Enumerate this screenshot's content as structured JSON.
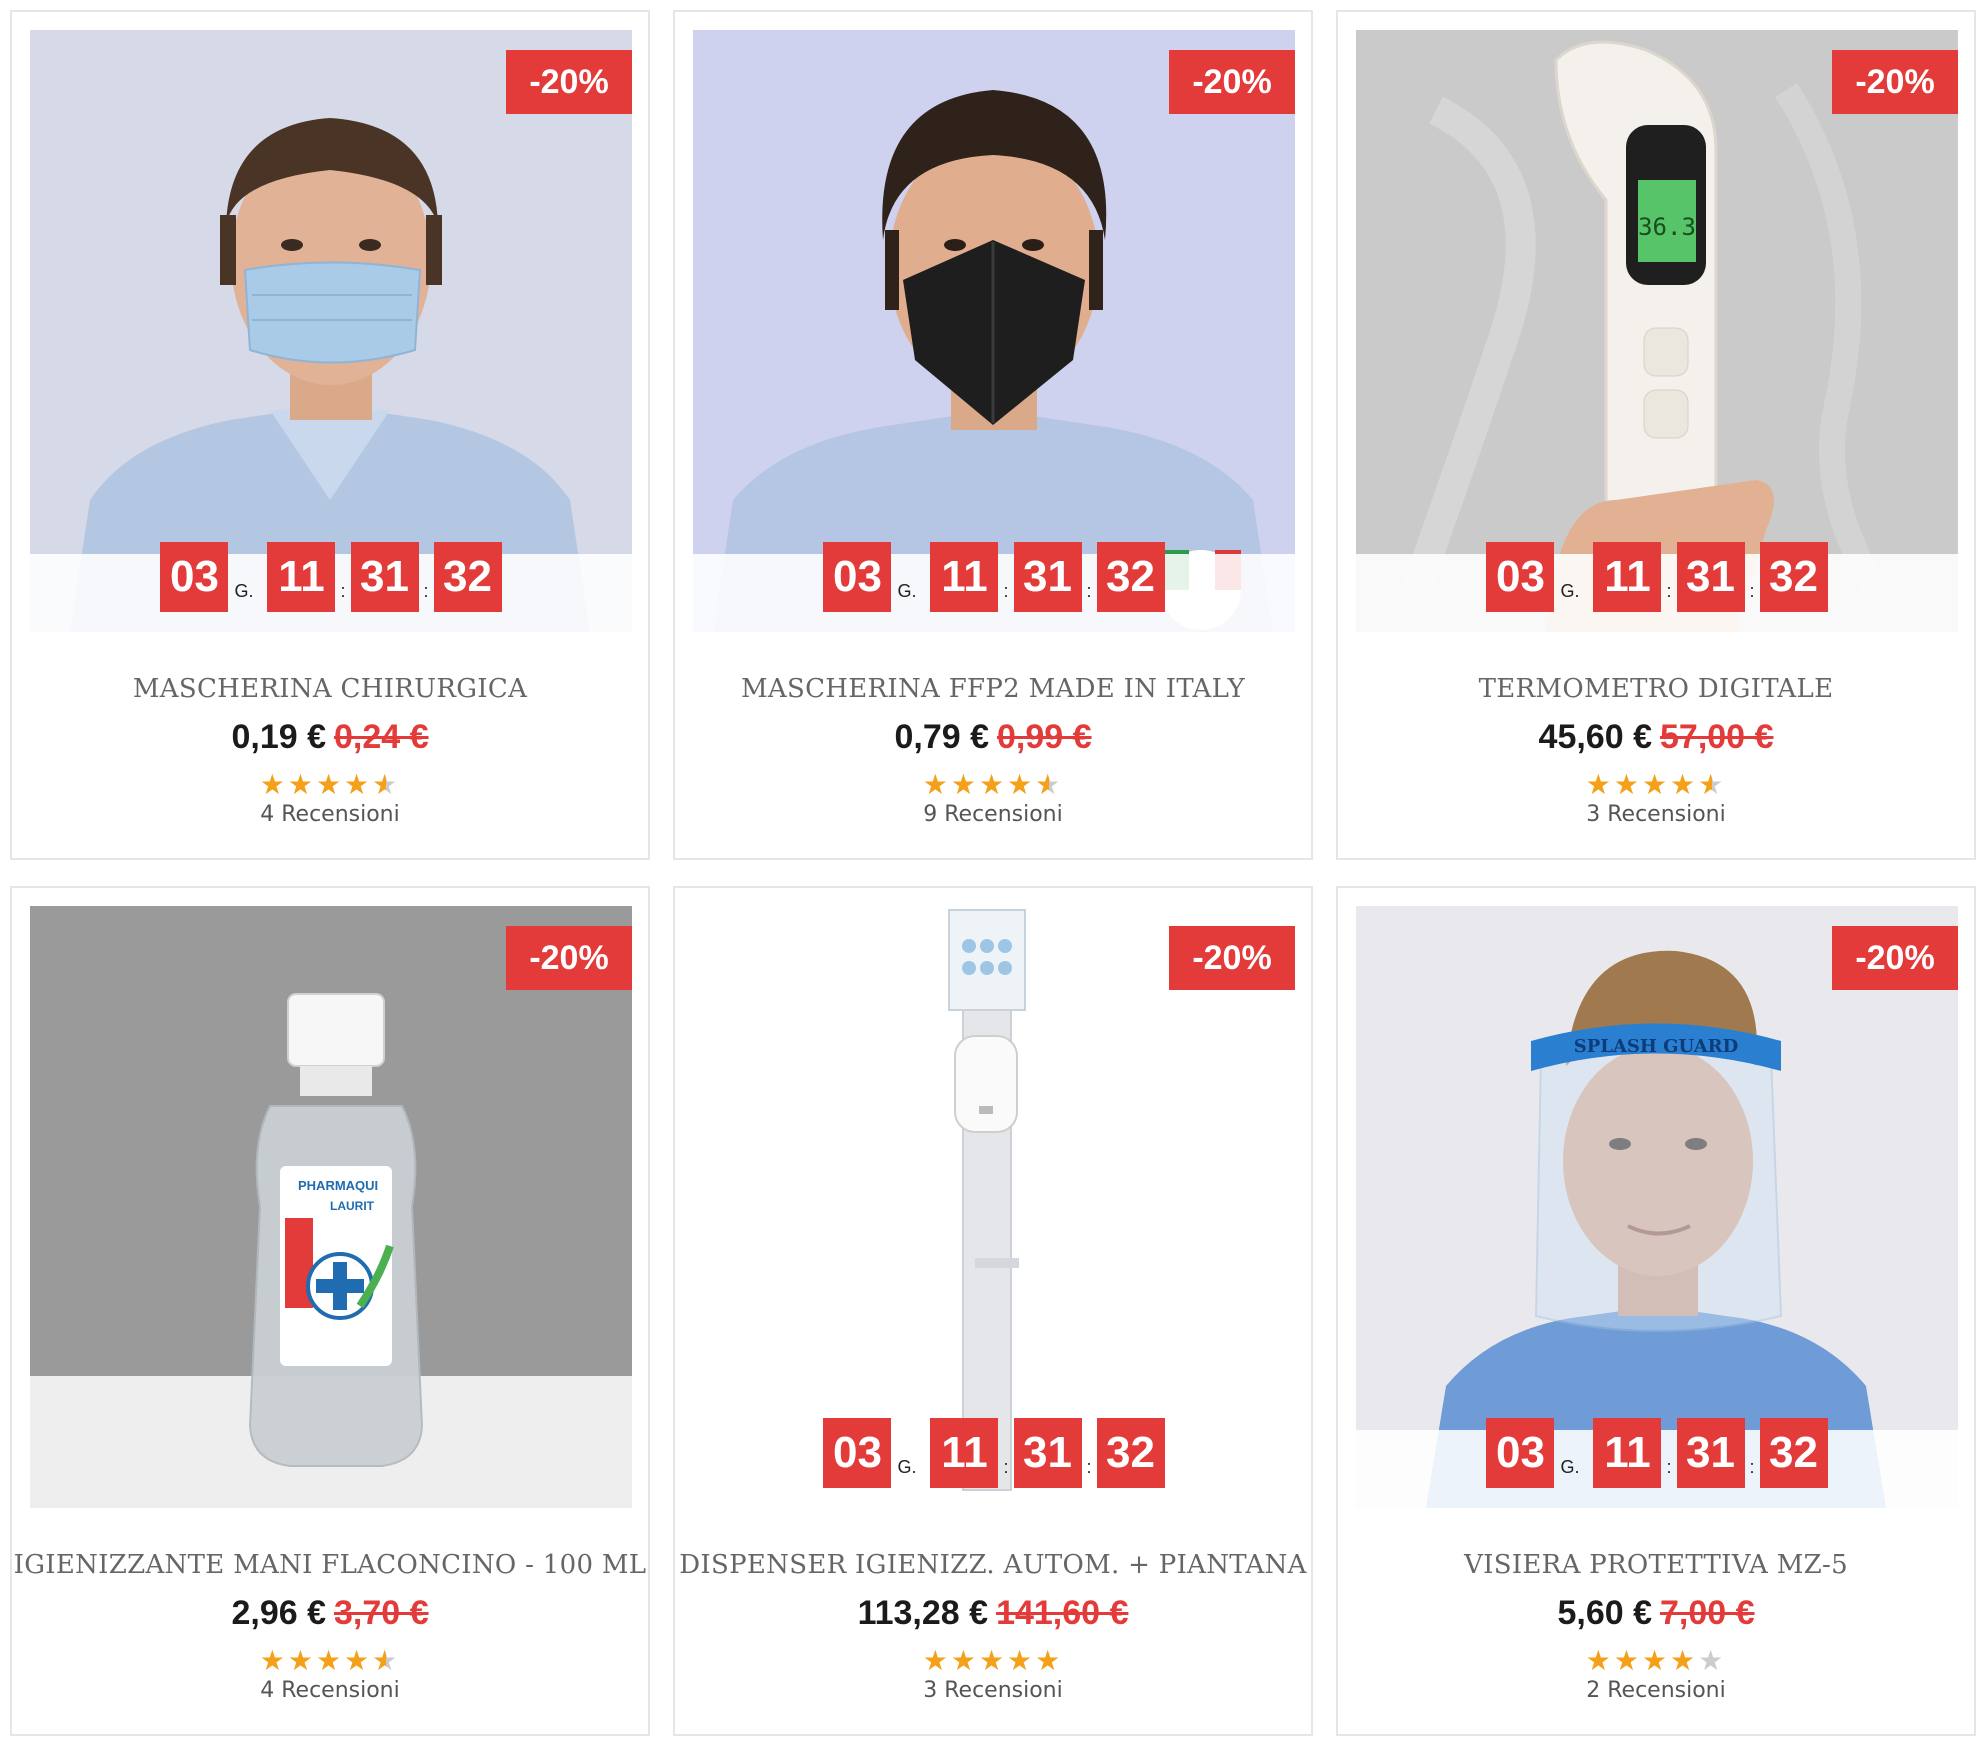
{
  "products": [
    {
      "title": "MASCHERINA CHIRURGICA",
      "price": "0,19 €",
      "old_price": "0,24 €",
      "discount": "-20%",
      "countdown": {
        "days": "03",
        "days_label": "G.",
        "hours": "11",
        "minutes": "31",
        "seconds": "32",
        "separator": ":"
      },
      "rating": 4.5,
      "reviews": "4 Recensioni",
      "image": "man-surgical-mask-photo"
    },
    {
      "title": "MASCHERINA FFP2 MADE IN ITALY",
      "price": "0,79 €",
      "old_price": "0,99 €",
      "discount": "-20%",
      "countdown": {
        "days": "03",
        "days_label": "G.",
        "hours": "11",
        "minutes": "31",
        "seconds": "32",
        "separator": ":"
      },
      "rating": 4.5,
      "reviews": "9 Recensioni",
      "image": "man-black-ffp2-mask-photo"
    },
    {
      "title": "TERMOMETRO DIGITALE",
      "price": "45,60 €",
      "old_price": "57,00 €",
      "discount": "-20%",
      "countdown": {
        "days": "03",
        "days_label": "G.",
        "hours": "11",
        "minutes": "31",
        "seconds": "32",
        "separator": ":"
      },
      "rating": 4.5,
      "reviews": "3 Recensioni",
      "image": "digital-thermometer-photo",
      "thermometer_reading": "36.3"
    },
    {
      "title": "IGIENIZZANTE MANI FLACONCINO - 100 ML",
      "price": "2,96 €",
      "old_price": "3,70 €",
      "discount": "-20%",
      "countdown": null,
      "rating": 4.5,
      "reviews": "4 Recensioni",
      "image": "hand-sanitizer-bottle-photo",
      "bottle_brand": "PHARMAQUI",
      "bottle_label": "LAURIT"
    },
    {
      "title": "DISPENSER IGIENIZZ. AUTOM. + PIANTANA",
      "price": "113,28 €",
      "old_price": "141,60 €",
      "discount": "-20%",
      "countdown": {
        "days": "03",
        "days_label": "G.",
        "hours": "11",
        "minutes": "31",
        "seconds": "32",
        "separator": ":"
      },
      "rating": 5,
      "reviews": "3 Recensioni",
      "image": "sanitizer-dispenser-stand-photo"
    },
    {
      "title": "VISIERA PROTETTIVA MZ-5",
      "price": "5,60 €",
      "old_price": "7,00 €",
      "discount": "-20%",
      "countdown": {
        "days": "03",
        "days_label": "G.",
        "hours": "11",
        "minutes": "31",
        "seconds": "32",
        "separator": ":"
      },
      "rating": 4,
      "reviews": "2 Recensioni",
      "image": "man-face-shield-photo",
      "visor_band_text": "SPLASH GUARD"
    }
  ],
  "colors": {
    "accent": "#e33a3a",
    "star": "#f4a018",
    "star_empty": "#cccccc",
    "title": "#666666",
    "border": "#e6e6e6"
  }
}
